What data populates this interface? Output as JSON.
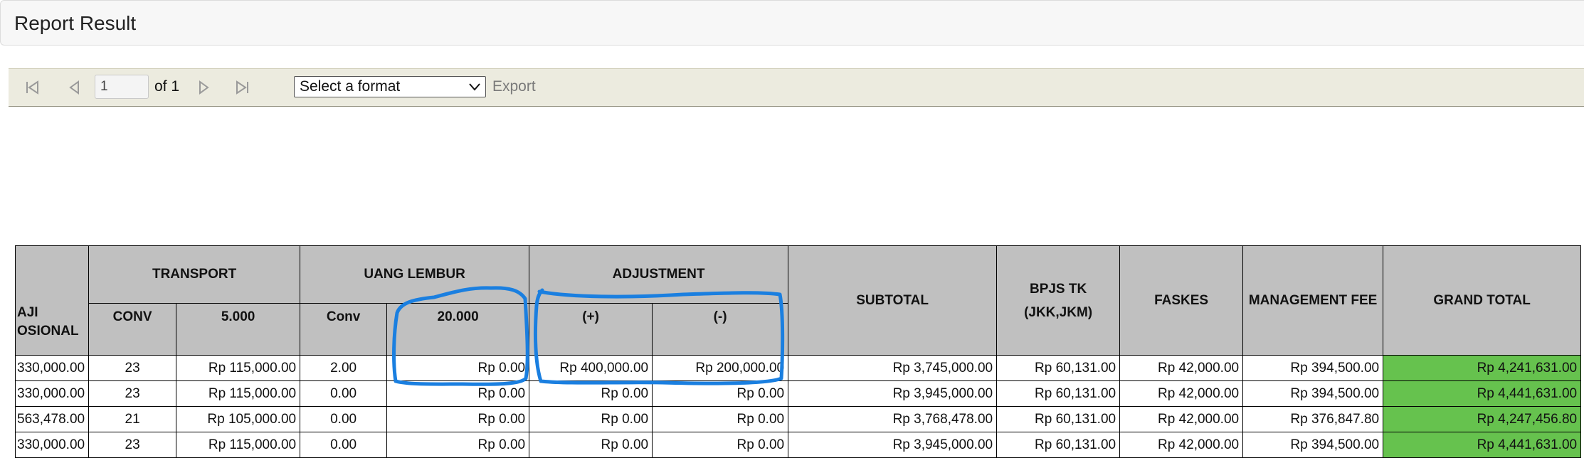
{
  "header": {
    "title": "Report Result"
  },
  "toolbar": {
    "first_icon": "first-page-icon",
    "prev_icon": "previous-page-icon",
    "page_value": "1",
    "of_label": "of 1",
    "next_icon": "next-page-icon",
    "last_icon": "last-page-icon",
    "format_selected": "Select a format",
    "export_label": "Export"
  },
  "table": {
    "headers": {
      "gaji_operasional": "AJI\nOSIONAL",
      "transport": "TRANSPORT",
      "transport_conv": "CONV",
      "transport_rate": "5.000",
      "uang_lembur": "UANG LEMBUR",
      "lembur_conv": "Conv",
      "lembur_rate": "20.000",
      "adjustment": "ADJUSTMENT",
      "adj_plus": "(+)",
      "adj_minus": "(-)",
      "subtotal": "SUBTOTAL",
      "bpjs_tk": "BPJS TK\n(JKK,JKM)",
      "faskes": "FASKES",
      "management_fee": "MANAGEMENT FEE",
      "grand_total": "GRAND TOTAL"
    },
    "rows": [
      [
        "330,000.00",
        "23",
        "Rp 115,000.00",
        "2.00",
        "Rp 0.00",
        "Rp 400,000.00",
        "Rp 200,000.00",
        "Rp 3,745,000.00",
        "Rp 60,131.00",
        "Rp 42,000.00",
        "Rp 394,500.00",
        "Rp 4,241,631.00"
      ],
      [
        "330,000.00",
        "23",
        "Rp 115,000.00",
        "0.00",
        "Rp 0.00",
        "Rp 0.00",
        "Rp 0.00",
        "Rp 3,945,000.00",
        "Rp 60,131.00",
        "Rp 42,000.00",
        "Rp 394,500.00",
        "Rp 4,441,631.00"
      ],
      [
        "563,478.00",
        "21",
        "Rp 105,000.00",
        "0.00",
        "Rp 0.00",
        "Rp 0.00",
        "Rp 0.00",
        "Rp 3,768,478.00",
        "Rp 60,131.00",
        "Rp 42,000.00",
        "Rp 376,847.80",
        "Rp 4,247,456.80"
      ],
      [
        "330,000.00",
        "23",
        "Rp 115,000.00",
        "0.00",
        "Rp 0.00",
        "Rp 0.00",
        "Rp 0.00",
        "Rp 3,945,000.00",
        "Rp 60,131.00",
        "Rp 42,000.00",
        "Rp 394,500.00",
        "Rp 4,441,631.00"
      ]
    ]
  },
  "colors": {
    "header_background": "#c0c0c0",
    "grand_total_background": "#66c24e",
    "annotation_stroke": "#1a7fe0",
    "toolbar_background": "#ecebdf"
  }
}
